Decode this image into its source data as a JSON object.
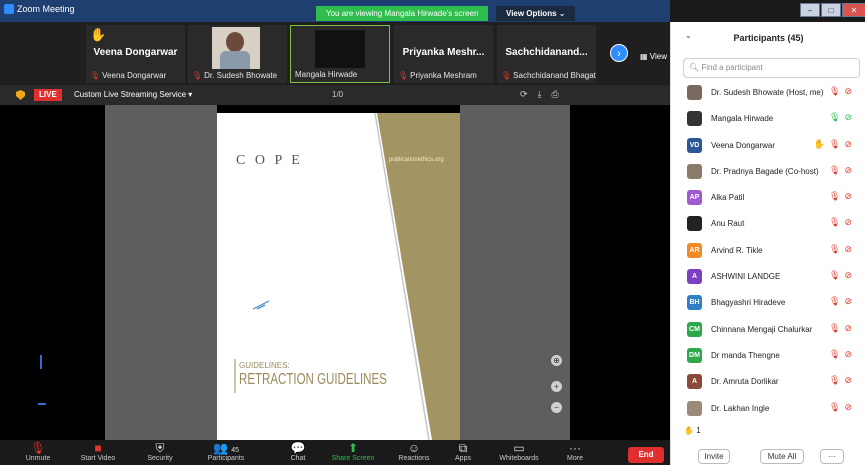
{
  "window": {
    "title": "Zoom Meeting",
    "viewing_banner": "You are viewing Mangala Hirwade's screen",
    "view_options": "View Options ⌄",
    "view_label": "▦ View"
  },
  "thumbnails": [
    {
      "big": "Veena Dongarwar",
      "label": "Veena Dongarwar"
    },
    {
      "big": "",
      "label": "Dr. Sudesh Bhowate"
    },
    {
      "big": "",
      "label": "Mangala Hirwade"
    },
    {
      "big": "Priyanka Meshr...",
      "label": "Priyanka Meshram"
    },
    {
      "big": "Sachchidanand...",
      "label": "Sachchidanand Bhagat"
    }
  ],
  "share_bar": {
    "live": "LIVE",
    "custom": "Custom Live Streaming Service ▾",
    "page": "1/0"
  },
  "document": {
    "cope": "C O P E",
    "pub": "publicationethics.org",
    "guidelines": "GUIDELINES:",
    "title": "RETRACTION GUIDELINES"
  },
  "toolbar": {
    "unmute": "Unmute",
    "start_video": "Start Video",
    "security": "Security",
    "participants": "Participants",
    "participants_count": "45",
    "chat": "Chat",
    "share": "Share Screen",
    "reactions": "Reactions",
    "apps": "Apps",
    "whiteboards": "Whiteboards",
    "more": "More",
    "end": "End"
  },
  "panel": {
    "title": "Participants (45)",
    "search_placeholder": "Find a participant",
    "hand_count": "1",
    "invite": "Invite",
    "mute_all": "Mute All",
    "more": "···",
    "participants": [
      {
        "name": "Dr. Sudesh Bhowate (Host, me)",
        "initials": "",
        "color": "#7a6a5e"
      },
      {
        "name": "Mangala Hirwade",
        "initials": "",
        "color": "#333333"
      },
      {
        "name": "Veena Dongarwar",
        "initials": "VD",
        "color": "#2b5797"
      },
      {
        "name": "Dr. Pradnya Bagade (Co-host)",
        "initials": "",
        "color": "#8a7a6a"
      },
      {
        "name": "Alka Patil",
        "initials": "AP",
        "color": "#a05ad0"
      },
      {
        "name": "Anu Raut",
        "initials": "",
        "color": "#222222"
      },
      {
        "name": "Arvind R. Tikle",
        "initials": "AR",
        "color": "#f08a24"
      },
      {
        "name": "ASHWINI LANDGE",
        "initials": "A",
        "color": "#7b3fc4"
      },
      {
        "name": "Bhagyashri Hiradeve",
        "initials": "BH",
        "color": "#2f7fc7"
      },
      {
        "name": "Chinnana Mengaji Chalurkar",
        "initials": "CM",
        "color": "#2ea84a"
      },
      {
        "name": "Dr manda Thengne",
        "initials": "DM",
        "color": "#2ea84a"
      },
      {
        "name": "Dr. Amruta Dorlikar",
        "initials": "A",
        "color": "#8a4a3a"
      },
      {
        "name": "Dr. Lakhan Ingle",
        "initials": "",
        "color": "#9a8a7a"
      }
    ]
  }
}
